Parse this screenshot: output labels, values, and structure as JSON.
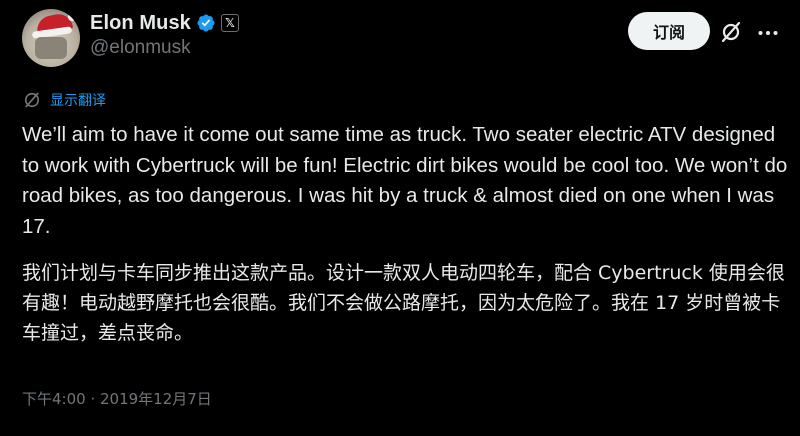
{
  "author": {
    "display_name": "Elon Musk",
    "handle": "@elonmusk",
    "verified": true,
    "affiliate_badge": "𝕏"
  },
  "actions": {
    "subscribe_label": "订阅",
    "grok_icon": "grok-icon",
    "more_icon": "more-icon"
  },
  "translate": {
    "label": "显示翻译"
  },
  "post": {
    "text_en": "We’ll aim to have it come out same time as truck. Two seater electric ATV designed to work with Cybertruck will be fun! Electric dirt bikes would be cool too. We won’t do road bikes, as too dangerous. I was hit by a truck & almost died on one when I was 17.",
    "text_zh": "我们计划与卡车同步推出这款产品。设计一款双人电动四轮车，配合 Cybertruck 使用会很有趣！电动越野摩托也会很酷。我们不会做公路摩托，因为太危险了。我在 17 岁时曾被卡车撞过，差点丧命。",
    "timestamp": "下午4:00 · 2019年12月7日"
  },
  "colors": {
    "background": "#000000",
    "text_primary": "#e7e9ea",
    "text_secondary": "#71767b",
    "link_blue": "#1d9bf0",
    "verified_blue": "#1d9bf0",
    "button_bg": "#eff3f4"
  }
}
